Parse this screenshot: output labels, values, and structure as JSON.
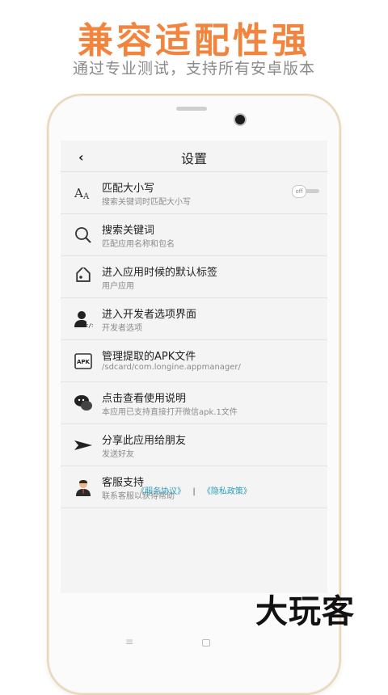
{
  "promo": {
    "title": "兼容适配性强",
    "subtitle": "通过专业测试，支持所有安卓版本"
  },
  "header": {
    "title": "设置",
    "back_icon": "back-icon"
  },
  "settings": [
    {
      "icon": "letter-case-icon",
      "label": "匹配大小写",
      "sublabel": "搜索关键词时匹配大小写",
      "toggle": "off"
    },
    {
      "icon": "search-icon",
      "label": "搜索关键词",
      "sublabel": "匹配应用名称和包名"
    },
    {
      "icon": "tag-icon",
      "label": "进入应用时候的默认标签",
      "sublabel": "用户应用"
    },
    {
      "icon": "developer-icon",
      "label": "进入开发者选项界面",
      "sublabel": "开发者选项"
    },
    {
      "icon": "apk-icon",
      "label": "管理提取的APK文件",
      "sublabel": "/sdcard/com.longine.appmanager/",
      "icon_text": "APK"
    },
    {
      "icon": "chat-icon",
      "label": "点击查看使用说明",
      "sublabel": "本应用已支持直接打开微信apk.1文件"
    },
    {
      "icon": "send-icon",
      "label": "分享此应用给朋友",
      "sublabel": "发送好友"
    },
    {
      "icon": "support-agent-icon",
      "label": "客服支持",
      "sublabel": "联系客服以获得帮助"
    }
  ],
  "footer": {
    "service_link": "《服务协议》",
    "separator": "|",
    "privacy_link": "《隐私政策》"
  },
  "watermark": "大玩客",
  "colors": {
    "promo_orange": "#f2843d",
    "link_blue": "#2a9db7",
    "phone_gold": "#e7d6b8"
  }
}
